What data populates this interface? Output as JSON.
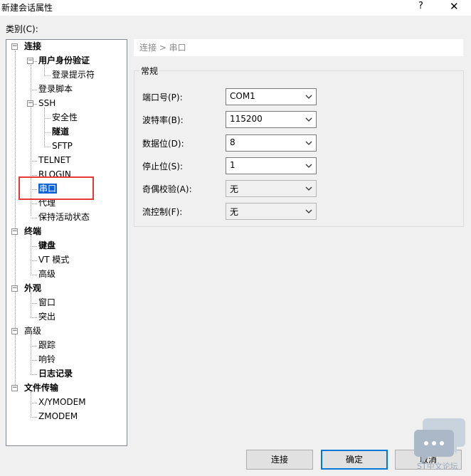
{
  "window": {
    "title": "新建会话属性",
    "help_label": "?",
    "close_label": "✕"
  },
  "category_label": "类别(C):",
  "tree": [
    {
      "label": "连接",
      "bold": true,
      "expander": "−"
    },
    {
      "label": "用户身份验证",
      "bold": true,
      "expander": "−"
    },
    {
      "label": "登录提示符"
    },
    {
      "label": "登录脚本"
    },
    {
      "label": "SSH",
      "expander": "−"
    },
    {
      "label": "安全性"
    },
    {
      "label": "隧道",
      "bold": true
    },
    {
      "label": "SFTP"
    },
    {
      "label": "TELNET"
    },
    {
      "label": "RLOGIN"
    },
    {
      "label": "串口",
      "selected": true
    },
    {
      "label": "代理"
    },
    {
      "label": "保持活动状态"
    },
    {
      "label": "终端",
      "bold": true,
      "expander": "−"
    },
    {
      "label": "键盘",
      "bold": true
    },
    {
      "label": "VT 模式"
    },
    {
      "label": "高级"
    },
    {
      "label": "外观",
      "bold": true,
      "expander": "−"
    },
    {
      "label": "窗口"
    },
    {
      "label": "突出"
    },
    {
      "label": "高级",
      "expander": "−"
    },
    {
      "label": "跟踪"
    },
    {
      "label": "响铃"
    },
    {
      "label": "日志记录",
      "bold": true
    },
    {
      "label": "文件传输",
      "bold": true,
      "expander": "−"
    },
    {
      "label": "X/YMODEM"
    },
    {
      "label": "ZMODEM"
    }
  ],
  "breadcrumb": "连接 > 串口",
  "group_title": "常规",
  "fields": [
    {
      "label": "端口号(P):",
      "value": "COM1"
    },
    {
      "label": "波特率(B):",
      "value": "115200"
    },
    {
      "label": "数据位(D):",
      "value": "8"
    },
    {
      "label": "停止位(S):",
      "value": "1"
    },
    {
      "label": "奇偶校验(A):",
      "value": "无"
    },
    {
      "label": "流控制(F):",
      "value": "无"
    }
  ],
  "buttons": {
    "connect": "连接",
    "ok": "确定",
    "cancel": "取消"
  },
  "watermark_text": "ST中文论坛",
  "colors": {
    "selection": "#0a64d8",
    "highlight_box": "#e53935",
    "default_button_border": "#0078d7"
  }
}
